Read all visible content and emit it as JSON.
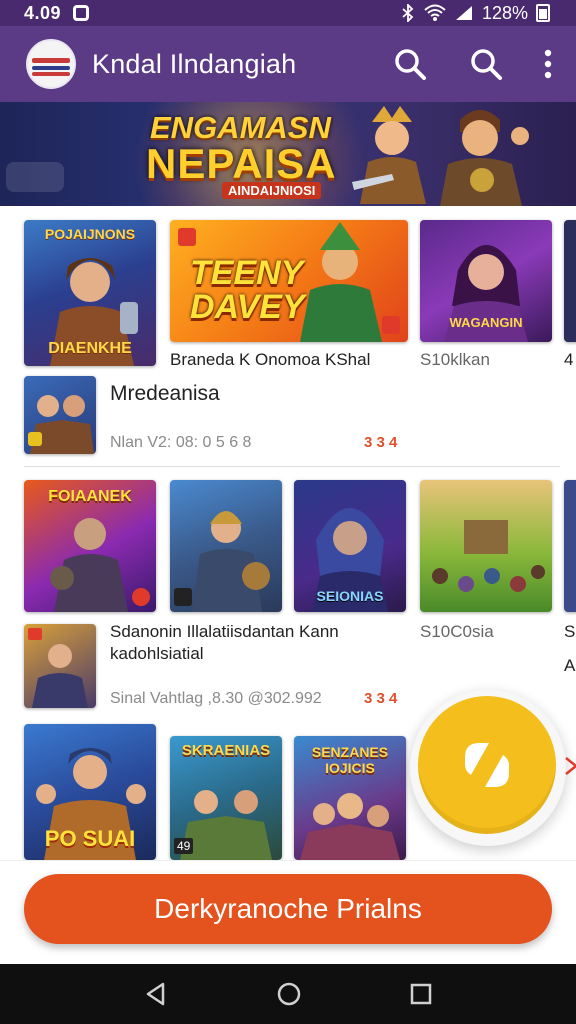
{
  "status_bar": {
    "time": "4.09",
    "battery": "128%"
  },
  "app_bar": {
    "title": "Kndal Ilndangiah",
    "icons": [
      "search-icon",
      "search-icon",
      "more-vert-icon"
    ]
  },
  "banner": {
    "line1": "ENGAMASN",
    "line2": "NEPAISA",
    "line3": "AINDAIJNIOSI"
  },
  "row1": {
    "tiles": [
      {
        "top": "POJAIJNONS",
        "bottom": "DIAENKHE"
      },
      {
        "text": "TEENY DAVEY"
      },
      {
        "bottom": "WAGANGIN"
      }
    ],
    "labels": [
      "Braneda K Onomoa KShal",
      "S10klkan",
      "4"
    ]
  },
  "item1": {
    "title": "Mredeanisa",
    "meta": "Nlan V2: 08: 0 5 6 8",
    "meta_right": "3 3 4"
  },
  "row2": {
    "tiles": [
      {
        "top": "FOIAANEK"
      },
      {},
      {
        "bottom": "SEIONIAS"
      },
      {}
    ],
    "labels": [
      "S10C0sia",
      "S"
    ]
  },
  "item2": {
    "title_line1": "Sdanonin Illalatiisdantan Kann",
    "title_line2": "kadohlsiatial",
    "meta": "Sinal Vahtlag ,8.30 @302.992",
    "meta_right": "3 3 4",
    "edge_label": "A"
  },
  "row3": {
    "tiles": [
      {
        "bottom": "PO SUAI"
      },
      {
        "top": "SKRAENIAS",
        "corner": "49"
      },
      {
        "top": "SENZANES IOJICIS"
      }
    ]
  },
  "fab": {
    "icon": "play-pause-icon"
  },
  "cta": {
    "label": "Derkyranoche Prialns"
  },
  "nav": {
    "icons": [
      "back-icon",
      "home-icon",
      "recents-icon"
    ]
  },
  "colors": {
    "app_bar": "#5b3a86",
    "status_bar": "#4a2a6e",
    "cta": "#e4521d",
    "fab": "#f4be1c"
  }
}
